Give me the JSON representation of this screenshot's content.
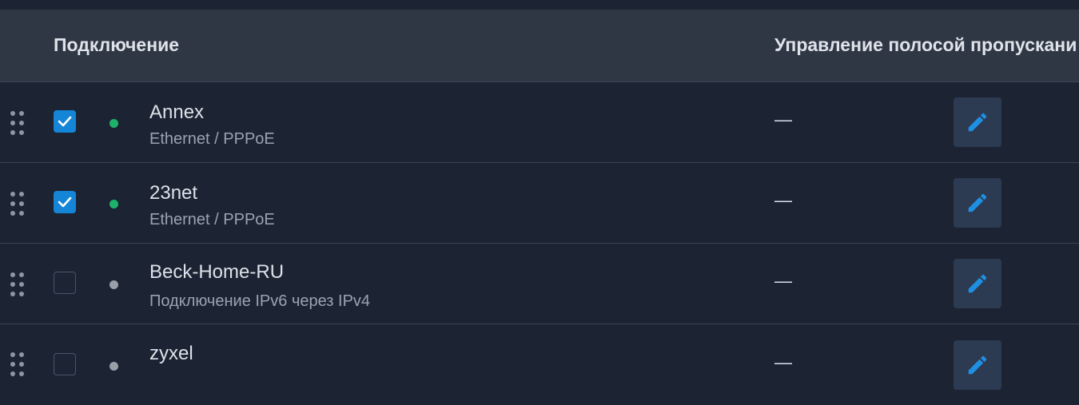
{
  "table": {
    "headers": {
      "connection": "Подключение",
      "bandwidth": "Управление полосой пропускани"
    },
    "rows": [
      {
        "name": "Annex",
        "type": "Ethernet / PPPoE",
        "enabled": true,
        "status_color": "#1db36b",
        "bandwidth": "—"
      },
      {
        "name": "23net",
        "type": "Ethernet / PPPoE",
        "enabled": true,
        "status_color": "#1db36b",
        "bandwidth": "—"
      },
      {
        "name": "Beck-Home-RU",
        "type": "Подключение IPv6 через IPv4",
        "enabled": false,
        "status_color": "#9aa0a8",
        "bandwidth": "—"
      },
      {
        "name": "zyxel",
        "type": "",
        "enabled": false,
        "status_color": "#9aa0a8",
        "bandwidth": "—"
      }
    ]
  },
  "icons": {
    "drag": "drag-handle-icon",
    "check": "check-icon",
    "edit": "pencil-icon"
  },
  "colors": {
    "accent": "#1585d8",
    "online": "#1db36b",
    "offline": "#9aa0a8"
  }
}
